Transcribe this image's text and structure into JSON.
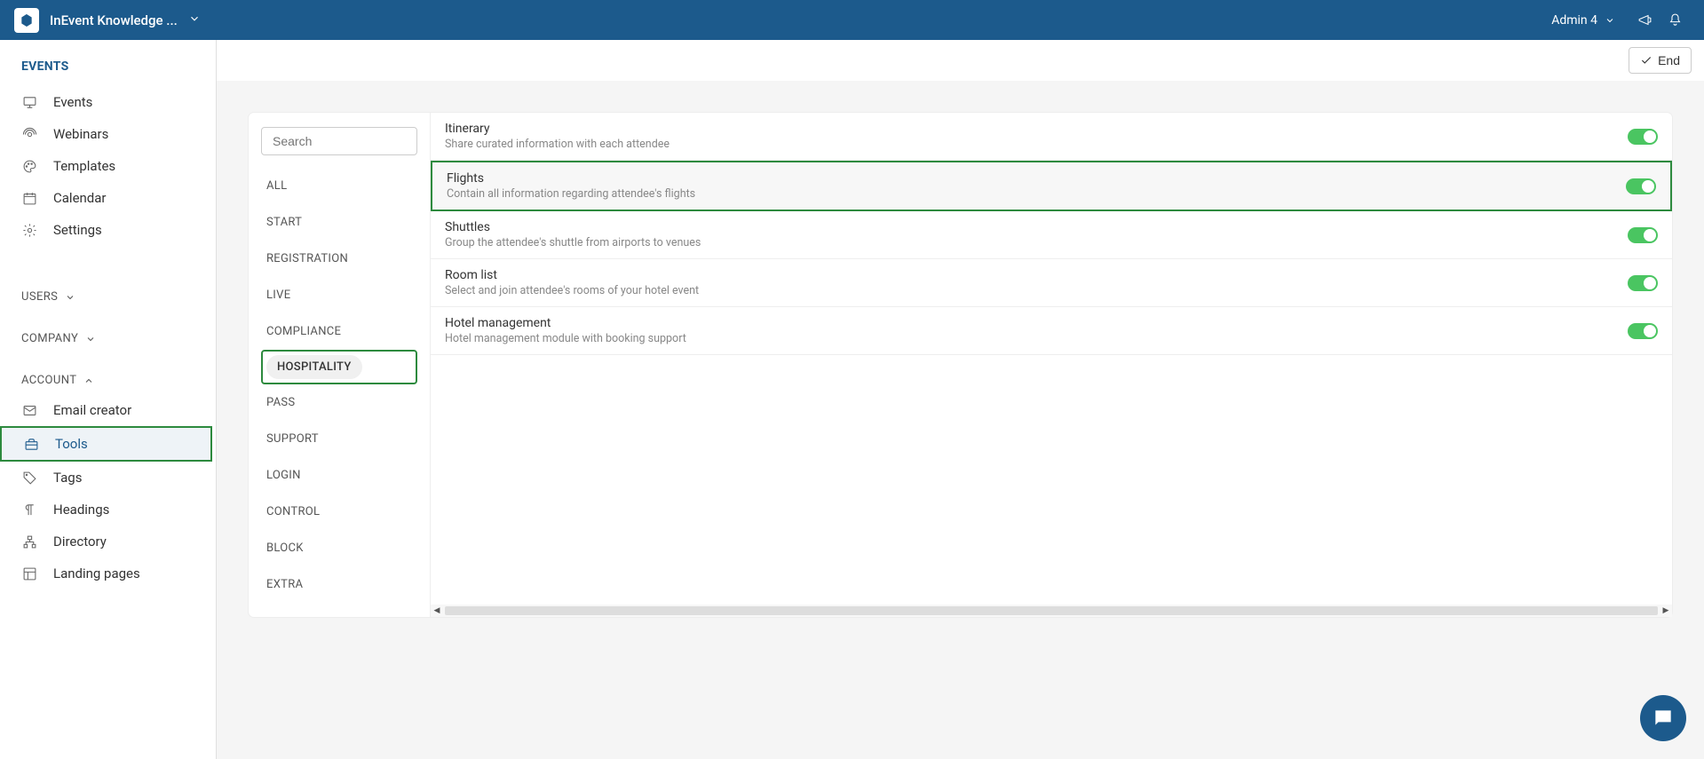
{
  "topbar": {
    "title": "InEvent Knowledge ...",
    "user": "Admin 4"
  },
  "sidebar": {
    "header": "EVENTS",
    "main_items": [
      {
        "label": "Events",
        "icon": "monitor"
      },
      {
        "label": "Webinars",
        "icon": "webinar"
      },
      {
        "label": "Templates",
        "icon": "palette"
      },
      {
        "label": "Calendar",
        "icon": "calendar"
      },
      {
        "label": "Settings",
        "icon": "gear"
      }
    ],
    "groups": {
      "users": "USERS",
      "company": "COMPANY",
      "account": "ACCOUNT"
    },
    "account_items": [
      {
        "label": "Email creator",
        "icon": "mail"
      },
      {
        "label": "Tools",
        "icon": "toolbox",
        "active": true,
        "highlight": true
      },
      {
        "label": "Tags",
        "icon": "tag"
      },
      {
        "label": "Headings",
        "icon": "paragraph"
      },
      {
        "label": "Directory",
        "icon": "sitemap"
      },
      {
        "label": "Landing pages",
        "icon": "layout"
      }
    ]
  },
  "content_header": {
    "end_label": "End"
  },
  "panel": {
    "search_placeholder": "Search",
    "nav": [
      "ALL",
      "START",
      "REGISTRATION",
      "LIVE",
      "COMPLIANCE",
      "HOSPITALITY",
      "PASS",
      "SUPPORT",
      "LOGIN",
      "CONTROL",
      "BLOCK",
      "EXTRA"
    ],
    "nav_active": "HOSPITALITY",
    "settings": [
      {
        "title": "Itinerary",
        "desc": "Share curated information with each attendee",
        "on": true,
        "highlight": false
      },
      {
        "title": "Flights",
        "desc": "Contain all information regarding attendee's flights",
        "on": true,
        "highlight": true
      },
      {
        "title": "Shuttles",
        "desc": "Group the attendee's shuttle from airports to venues",
        "on": true,
        "highlight": false
      },
      {
        "title": "Room list",
        "desc": "Select and join attendee's rooms of your hotel event",
        "on": true,
        "highlight": false
      },
      {
        "title": "Hotel management",
        "desc": "Hotel management module with booking support",
        "on": true,
        "highlight": false
      }
    ]
  }
}
